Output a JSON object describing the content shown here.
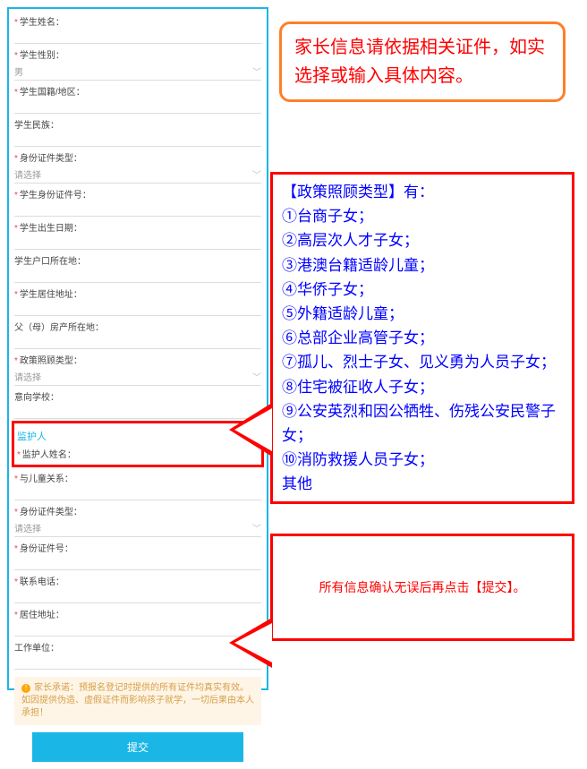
{
  "form": {
    "fields": [
      {
        "label": "学生姓名",
        "required": true,
        "type": "text",
        "value": ""
      },
      {
        "label": "学生性别",
        "required": true,
        "type": "select",
        "value": "男"
      },
      {
        "label": "学生国籍/地区",
        "required": true,
        "type": "text",
        "value": ""
      },
      {
        "label": "学生民族",
        "required": false,
        "type": "text",
        "value": ""
      },
      {
        "label": "身份证件类型",
        "required": true,
        "type": "select",
        "value": "请选择"
      },
      {
        "label": "学生身份证件号",
        "required": true,
        "type": "text",
        "value": ""
      },
      {
        "label": "学生出生日期",
        "required": true,
        "type": "text",
        "value": ""
      },
      {
        "label": "学生户口所在地",
        "required": false,
        "type": "text",
        "value": ""
      },
      {
        "label": "学生居住地址",
        "required": true,
        "type": "text",
        "value": ""
      },
      {
        "label": "父（母）房产所在地",
        "required": false,
        "type": "text",
        "value": ""
      },
      {
        "label": "政策照顾类型",
        "required": true,
        "type": "select",
        "value": "请选择"
      },
      {
        "label": "意向学校",
        "required": false,
        "type": "text",
        "value": ""
      }
    ],
    "guardian_section": "监护人",
    "guardian_name_label": "监护人姓名",
    "guardian_fields": [
      {
        "label": "与儿童关系",
        "required": true,
        "type": "text",
        "value": ""
      },
      {
        "label": "身份证件类型",
        "required": true,
        "type": "select",
        "value": "请选择"
      },
      {
        "label": "身份证件号",
        "required": true,
        "type": "text",
        "value": ""
      },
      {
        "label": "联系电话",
        "required": true,
        "type": "text",
        "value": ""
      },
      {
        "label": "居住地址",
        "required": true,
        "type": "text",
        "value": ""
      },
      {
        "label": "工作单位",
        "required": false,
        "type": "text",
        "value": ""
      }
    ],
    "declaration": "家长承诺：预报名登记时提供的所有证件均真实有效。如因提供伪造、虚假证件而影响孩子就学，一切后果由本人承担！",
    "submit_label": "提交"
  },
  "callouts": {
    "c1": "家长信息请依据相关证件，如实选择或输入具体内容。",
    "c2_heading": "【政策照顾类型】有：",
    "c2_items": [
      "①台商子女；",
      "②高层次人才子女；",
      "③港澳台籍适龄儿童；",
      "④华侨子女；",
      "⑤外籍适龄儿童；",
      "⑥总部企业高管子女；",
      "⑦孤儿、烈士子女、见义勇为人员子女；",
      "⑧住宅被征收人子女；",
      "⑨公安英烈和因公牺牲、伤残公安民警子女；",
      "⑩消防救援人员子女；",
      "其他"
    ],
    "c3": "所有信息确认无误后再点击【提交】。"
  }
}
